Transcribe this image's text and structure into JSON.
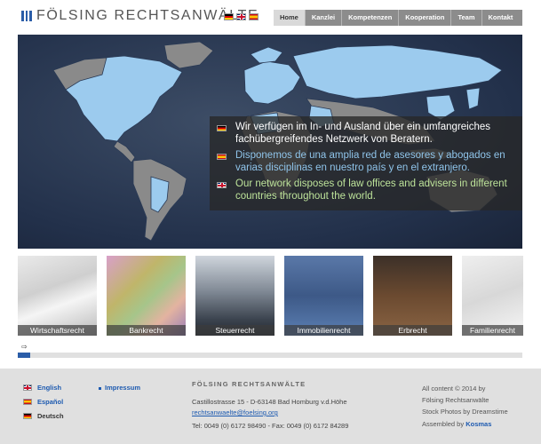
{
  "brand": "FÖLSING RECHTSANWÄLTE",
  "nav": [
    "Home",
    "Kanzlei",
    "Kompetenzen",
    "Kooperation",
    "Team",
    "Kontakt"
  ],
  "hero": {
    "de": "Wir verfügen im In- und Ausland über ein umfangreiches fachübergreifendes Netzwerk von Beratern.",
    "es": "Disponemos de una amplia red de asesores y abogados en varias disciplinas en nuestro país y en el extranjero.",
    "en": "Our network disposes of law offices and advisers in different countries throughout the world."
  },
  "thumbs": [
    "Wirtschaftsrecht",
    "Bankrecht",
    "Steuerrecht",
    "Immobilienrecht",
    "Erbrecht",
    "Familienrecht"
  ],
  "footer": {
    "langs": [
      "English",
      "Español",
      "Deutsch"
    ],
    "impressum": "Impressum",
    "firm": "FÖLSING RECHTSANWÄLTE",
    "address": "Castillostrasse 15 - D-63148 Bad Homburg v.d.Höhe",
    "email": "rechtsanwaelte@foelsing.org",
    "phone": "Tel: 0049 (0) 6172 98490 - Fax: 0049 (0) 6172 84289",
    "credits1": "All content © 2014 by",
    "credits2": "Fölsing Rechtsanwälte",
    "credits3": "Stock Photos by Dreamstime",
    "credits4_prefix": "Assembled by",
    "credits4_link": "Kosmas"
  },
  "colors": {
    "accent": "#2a5da8",
    "nav": "#8c8c8c",
    "footer": "#e0e0e0",
    "spanish_text": "#8fc4ea",
    "english_text": "#bde39a"
  }
}
